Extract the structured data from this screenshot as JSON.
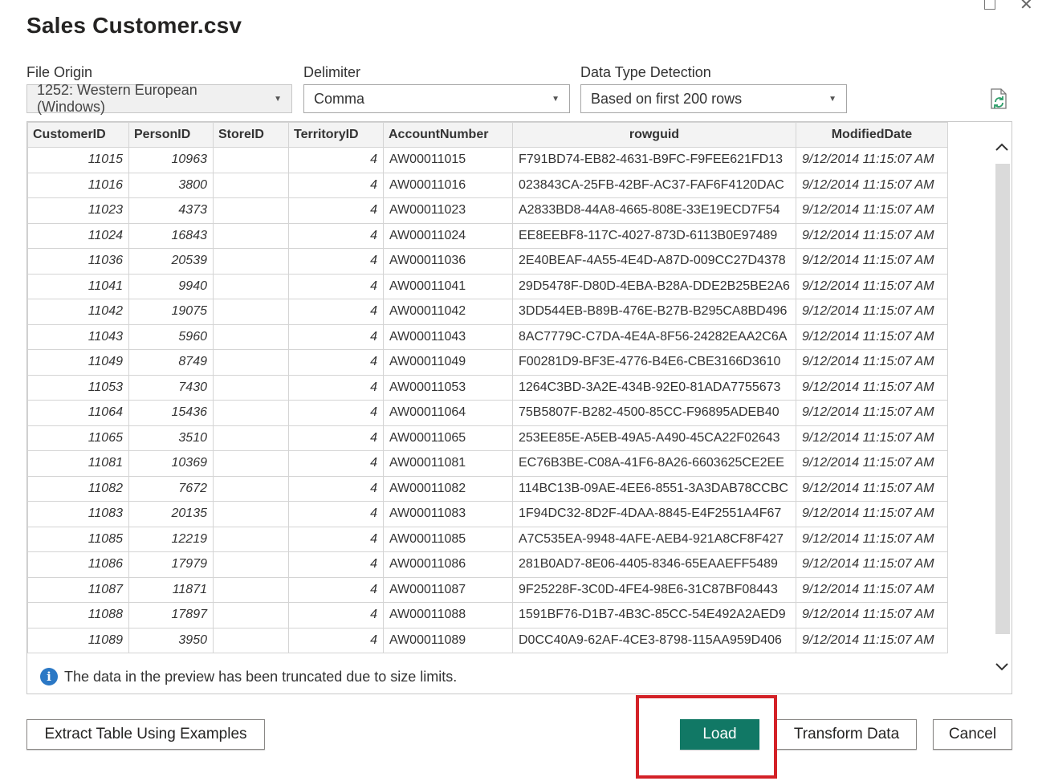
{
  "window": {
    "title": "Sales Customer.csv",
    "maximize_icon": "maximize-icon",
    "close_icon": "close-icon",
    "close_glyph": "✕"
  },
  "options": {
    "file_origin": {
      "label": "File Origin",
      "value": "1252: Western European (Windows)"
    },
    "delimiter": {
      "label": "Delimiter",
      "value": "Comma"
    },
    "data_type_detection": {
      "label": "Data Type Detection",
      "value": "Based on first 200 rows"
    },
    "refresh_icon": "refresh-file-icon"
  },
  "table": {
    "columns": [
      "CustomerID",
      "PersonID",
      "StoreID",
      "TerritoryID",
      "AccountNumber",
      "rowguid",
      "ModifiedDate"
    ],
    "rows": [
      [
        "11015",
        "10963",
        "",
        "4",
        "AW00011015",
        "F791BD74-EB82-4631-B9FC-F9FEE621FD13",
        "9/12/2014 11:15:07 AM"
      ],
      [
        "11016",
        "3800",
        "",
        "4",
        "AW00011016",
        "023843CA-25FB-42BF-AC37-FAF6F4120DAC",
        "9/12/2014 11:15:07 AM"
      ],
      [
        "11023",
        "4373",
        "",
        "4",
        "AW00011023",
        "A2833BD8-44A8-4665-808E-33E19ECD7F54",
        "9/12/2014 11:15:07 AM"
      ],
      [
        "11024",
        "16843",
        "",
        "4",
        "AW00011024",
        "EE8EEBF8-117C-4027-873D-6113B0E97489",
        "9/12/2014 11:15:07 AM"
      ],
      [
        "11036",
        "20539",
        "",
        "4",
        "AW00011036",
        "2E40BEAF-4A55-4E4D-A87D-009CC27D4378",
        "9/12/2014 11:15:07 AM"
      ],
      [
        "11041",
        "9940",
        "",
        "4",
        "AW00011041",
        "29D5478F-D80D-4EBA-B28A-DDE2B25BE2A6",
        "9/12/2014 11:15:07 AM"
      ],
      [
        "11042",
        "19075",
        "",
        "4",
        "AW00011042",
        "3DD544EB-B89B-476E-B27B-B295CA8BD496",
        "9/12/2014 11:15:07 AM"
      ],
      [
        "11043",
        "5960",
        "",
        "4",
        "AW00011043",
        "8AC7779C-C7DA-4E4A-8F56-24282EAA2C6A",
        "9/12/2014 11:15:07 AM"
      ],
      [
        "11049",
        "8749",
        "",
        "4",
        "AW00011049",
        "F00281D9-BF3E-4776-B4E6-CBE3166D3610",
        "9/12/2014 11:15:07 AM"
      ],
      [
        "11053",
        "7430",
        "",
        "4",
        "AW00011053",
        "1264C3BD-3A2E-434B-92E0-81ADA7755673",
        "9/12/2014 11:15:07 AM"
      ],
      [
        "11064",
        "15436",
        "",
        "4",
        "AW00011064",
        "75B5807F-B282-4500-85CC-F96895ADEB40",
        "9/12/2014 11:15:07 AM"
      ],
      [
        "11065",
        "3510",
        "",
        "4",
        "AW00011065",
        "253EE85E-A5EB-49A5-A490-45CA22F02643",
        "9/12/2014 11:15:07 AM"
      ],
      [
        "11081",
        "10369",
        "",
        "4",
        "AW00011081",
        "EC76B3BE-C08A-41F6-8A26-6603625CE2EE",
        "9/12/2014 11:15:07 AM"
      ],
      [
        "11082",
        "7672",
        "",
        "4",
        "AW00011082",
        "114BC13B-09AE-4EE6-8551-3A3DAB78CCBC",
        "9/12/2014 11:15:07 AM"
      ],
      [
        "11083",
        "20135",
        "",
        "4",
        "AW00011083",
        "1F94DC32-8D2F-4DAA-8845-E4F2551A4F67",
        "9/12/2014 11:15:07 AM"
      ],
      [
        "11085",
        "12219",
        "",
        "4",
        "AW00011085",
        "A7C535EA-9948-4AFE-AEB4-921A8CF8F427",
        "9/12/2014 11:15:07 AM"
      ],
      [
        "11086",
        "17979",
        "",
        "4",
        "AW00011086",
        "281B0AD7-8E06-4405-8346-65EAAEFF5489",
        "9/12/2014 11:15:07 AM"
      ],
      [
        "11087",
        "11871",
        "",
        "4",
        "AW00011087",
        "9F25228F-3C0D-4FE4-98E6-31C87BF08443",
        "9/12/2014 11:15:07 AM"
      ],
      [
        "11088",
        "17897",
        "",
        "4",
        "AW00011088",
        "1591BF76-D1B7-4B3C-85CC-54E492A2AED9",
        "9/12/2014 11:15:07 AM"
      ],
      [
        "11089",
        "3950",
        "",
        "4",
        "AW00011089",
        "D0CC40A9-62AF-4CE3-8798-115AA959D406",
        "9/12/2014 11:15:07 AM"
      ]
    ]
  },
  "notice": {
    "icon": "info-icon",
    "glyph": "i",
    "text": "The data in the preview has been truncated due to size limits."
  },
  "buttons": {
    "extract": "Extract Table Using Examples",
    "load": "Load",
    "transform": "Transform Data",
    "cancel": "Cancel"
  },
  "colors": {
    "primary": "#117865",
    "highlight": "#d32127",
    "info": "#2b78c5"
  }
}
